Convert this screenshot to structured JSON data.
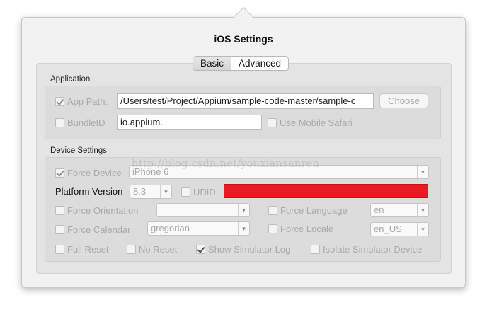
{
  "window": {
    "title": "iOS Settings"
  },
  "tabs": [
    {
      "label": "Basic",
      "active": true
    },
    {
      "label": "Advanced",
      "active": false
    }
  ],
  "application": {
    "label": "Application",
    "app_path": {
      "label": "App Path:",
      "checked": true,
      "value": "/Users/test/Project/Appium/sample-code-master/sample-c"
    },
    "choose_label": "Choose",
    "bundle_id": {
      "label": "BundleID",
      "checked": false,
      "value": "io.appium."
    },
    "mobile_safari": {
      "label": "Use Mobile Safari",
      "checked": false
    }
  },
  "device": {
    "label": "Device Settings",
    "force_device": {
      "label": "Force Device",
      "checked": true,
      "value": "iPhone 6"
    },
    "platform_version": {
      "label": "Platform Version",
      "value": "8.3"
    },
    "udid": {
      "label": "UDID",
      "checked": false,
      "value_redacted": true
    },
    "force_orientation": {
      "label": "Force Orientation",
      "checked": false,
      "value": ""
    },
    "force_language": {
      "label": "Force Language",
      "checked": false,
      "value": "en"
    },
    "force_calendar": {
      "label": "Force Calendar",
      "checked": false,
      "value": "gregorian"
    },
    "force_locale": {
      "label": "Force Locale",
      "checked": false,
      "value": "en_US"
    },
    "full_reset": {
      "label": "Full Reset",
      "checked": false
    },
    "no_reset": {
      "label": "No Reset",
      "checked": false
    },
    "show_sim_log": {
      "label": "Show Simulator Log",
      "checked": true
    },
    "isolate_sim": {
      "label": "Isolate Simulator Device",
      "checked": false
    }
  },
  "watermark": "http://blog.csdn.net/youxiansanren",
  "colors": {
    "redaction": "#ea1b24",
    "disabled_text": "#a9a9a9"
  }
}
